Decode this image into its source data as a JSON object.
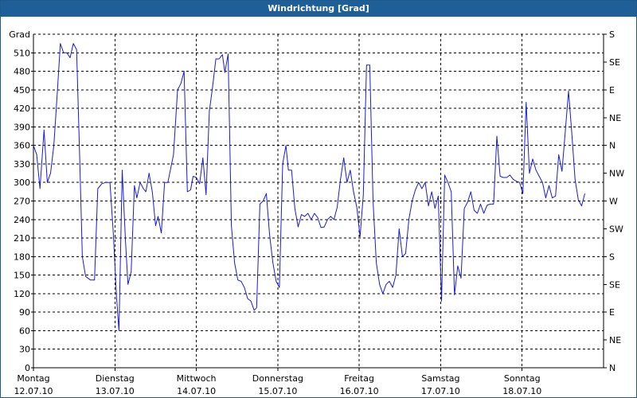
{
  "window": {
    "title": "Windrichtung [Grad]"
  },
  "colors": {
    "titlebar": "#1d5f96",
    "line": "#1a1ad6",
    "grid": "#000000"
  },
  "chart_data": {
    "type": "line",
    "title": "Windrichtung [Grad]",
    "ylabel": "Grad",
    "ylim": [
      0,
      540
    ],
    "grid": true,
    "yticks": [
      0,
      30,
      60,
      90,
      120,
      150,
      180,
      210,
      240,
      270,
      300,
      330,
      360,
      390,
      420,
      450,
      480,
      510
    ],
    "right_ticks": [
      {
        "value": 0,
        "label": "N"
      },
      {
        "value": 45,
        "label": "NE"
      },
      {
        "value": 90,
        "label": "E"
      },
      {
        "value": 135,
        "label": "SE"
      },
      {
        "value": 180,
        "label": "S"
      },
      {
        "value": 225,
        "label": "SW"
      },
      {
        "value": 270,
        "label": "W"
      },
      {
        "value": 315,
        "label": "NW"
      },
      {
        "value": 360,
        "label": "N"
      },
      {
        "value": 405,
        "label": "NE"
      },
      {
        "value": 450,
        "label": "E"
      },
      {
        "value": 495,
        "label": "SE"
      },
      {
        "value": 540,
        "label": "S"
      }
    ],
    "xlim": [
      0,
      7
    ],
    "day_labels": [
      {
        "day": "Montag",
        "date": "12.07.10"
      },
      {
        "day": "Dienstag",
        "date": "13.07.10"
      },
      {
        "day": "Mittwoch",
        "date": "14.07.10"
      },
      {
        "day": "Donnerstag",
        "date": "15.07.10"
      },
      {
        "day": "Freitag",
        "date": "16.07.10"
      },
      {
        "day": "Samstag",
        "date": "17.07.10"
      },
      {
        "day": "Sonntag",
        "date": "18.07.10"
      }
    ],
    "series": [
      {
        "points": [
          [
            0.0,
            360
          ],
          [
            0.04,
            345
          ],
          [
            0.08,
            290
          ],
          [
            0.13,
            385
          ],
          [
            0.17,
            300
          ],
          [
            0.21,
            315
          ],
          [
            0.25,
            360
          ],
          [
            0.29,
            440
          ],
          [
            0.33,
            525
          ],
          [
            0.37,
            510
          ],
          [
            0.41,
            510
          ],
          [
            0.45,
            502
          ],
          [
            0.49,
            525
          ],
          [
            0.53,
            515
          ],
          [
            0.57,
            330
          ],
          [
            0.6,
            180
          ],
          [
            0.64,
            148
          ],
          [
            0.7,
            142
          ],
          [
            0.75,
            142
          ],
          [
            0.79,
            290
          ],
          [
            0.84,
            298
          ],
          [
            0.89,
            300
          ],
          [
            0.94,
            300
          ],
          [
            0.98,
            220
          ],
          [
            1.02,
            115
          ],
          [
            1.05,
            60
          ],
          [
            1.09,
            320
          ],
          [
            1.13,
            205
          ],
          [
            1.16,
            135
          ],
          [
            1.2,
            155
          ],
          [
            1.24,
            295
          ],
          [
            1.27,
            275
          ],
          [
            1.31,
            300
          ],
          [
            1.35,
            290
          ],
          [
            1.38,
            285
          ],
          [
            1.42,
            315
          ],
          [
            1.46,
            285
          ],
          [
            1.5,
            230
          ],
          [
            1.53,
            245
          ],
          [
            1.57,
            218
          ],
          [
            1.61,
            300
          ],
          [
            1.65,
            300
          ],
          [
            1.72,
            345
          ],
          [
            1.77,
            450
          ],
          [
            1.81,
            460
          ],
          [
            1.85,
            480
          ],
          [
            1.89,
            285
          ],
          [
            1.93,
            288
          ],
          [
            1.96,
            310
          ],
          [
            2.0,
            308
          ],
          [
            2.04,
            298
          ],
          [
            2.08,
            340
          ],
          [
            2.12,
            280
          ],
          [
            2.16,
            415
          ],
          [
            2.2,
            455
          ],
          [
            2.24,
            500
          ],
          [
            2.28,
            500
          ],
          [
            2.32,
            507
          ],
          [
            2.35,
            478
          ],
          [
            2.39,
            508
          ],
          [
            2.43,
            230
          ],
          [
            2.47,
            170
          ],
          [
            2.51,
            142
          ],
          [
            2.55,
            140
          ],
          [
            2.59,
            130
          ],
          [
            2.63,
            112
          ],
          [
            2.67,
            108
          ],
          [
            2.71,
            93
          ],
          [
            2.74,
            97
          ],
          [
            2.78,
            265
          ],
          [
            2.82,
            270
          ],
          [
            2.86,
            282
          ],
          [
            2.9,
            215
          ],
          [
            2.94,
            170
          ],
          [
            2.98,
            140
          ],
          [
            3.02,
            130
          ],
          [
            3.06,
            330
          ],
          [
            3.1,
            360
          ],
          [
            3.13,
            320
          ],
          [
            3.17,
            320
          ],
          [
            3.21,
            258
          ],
          [
            3.25,
            228
          ],
          [
            3.29,
            248
          ],
          [
            3.33,
            245
          ],
          [
            3.37,
            250
          ],
          [
            3.41,
            240
          ],
          [
            3.45,
            250
          ],
          [
            3.49,
            243
          ],
          [
            3.53,
            227
          ],
          [
            3.57,
            228
          ],
          [
            3.61,
            240
          ],
          [
            3.65,
            245
          ],
          [
            3.69,
            240
          ],
          [
            3.73,
            260
          ],
          [
            3.77,
            305
          ],
          [
            3.81,
            340
          ],
          [
            3.85,
            300
          ],
          [
            3.89,
            320
          ],
          [
            3.93,
            285
          ],
          [
            3.97,
            260
          ],
          [
            4.01,
            212
          ],
          [
            4.05,
            280
          ],
          [
            4.09,
            490
          ],
          [
            4.13,
            490
          ],
          [
            4.17,
            270
          ],
          [
            4.21,
            170
          ],
          [
            4.25,
            135
          ],
          [
            4.29,
            120
          ],
          [
            4.33,
            135
          ],
          [
            4.37,
            140
          ],
          [
            4.41,
            130
          ],
          [
            4.45,
            150
          ],
          [
            4.49,
            225
          ],
          [
            4.53,
            180
          ],
          [
            4.57,
            185
          ],
          [
            4.61,
            240
          ],
          [
            4.65,
            270
          ],
          [
            4.69,
            288
          ],
          [
            4.73,
            300
          ],
          [
            4.77,
            290
          ],
          [
            4.81,
            300
          ],
          [
            4.85,
            262
          ],
          [
            4.89,
            285
          ],
          [
            4.93,
            258
          ],
          [
            4.97,
            278
          ],
          [
            5.01,
            108
          ],
          [
            5.05,
            312
          ],
          [
            5.09,
            300
          ],
          [
            5.13,
            285
          ],
          [
            5.17,
            118
          ],
          [
            5.21,
            165
          ],
          [
            5.25,
            145
          ],
          [
            5.29,
            258
          ],
          [
            5.33,
            268
          ],
          [
            5.37,
            285
          ],
          [
            5.41,
            255
          ],
          [
            5.45,
            250
          ],
          [
            5.49,
            265
          ],
          [
            5.53,
            250
          ],
          [
            5.57,
            263
          ],
          [
            5.61,
            265
          ],
          [
            5.65,
            265
          ],
          [
            5.69,
            375
          ],
          [
            5.73,
            310
          ],
          [
            5.77,
            308
          ],
          [
            5.81,
            308
          ],
          [
            5.85,
            312
          ],
          [
            5.89,
            305
          ],
          [
            5.93,
            302
          ],
          [
            5.97,
            300
          ],
          [
            6.01,
            282
          ],
          [
            6.05,
            430
          ],
          [
            6.09,
            315
          ],
          [
            6.13,
            338
          ],
          [
            6.17,
            320
          ],
          [
            6.21,
            310
          ],
          [
            6.25,
            300
          ],
          [
            6.29,
            275
          ],
          [
            6.33,
            295
          ],
          [
            6.37,
            275
          ],
          [
            6.41,
            278
          ],
          [
            6.45,
            345
          ],
          [
            6.49,
            318
          ],
          [
            6.53,
            382
          ],
          [
            6.57,
            448
          ],
          [
            6.61,
            380
          ],
          [
            6.65,
            305
          ],
          [
            6.69,
            272
          ],
          [
            6.73,
            262
          ],
          [
            6.77,
            282
          ]
        ]
      }
    ]
  }
}
